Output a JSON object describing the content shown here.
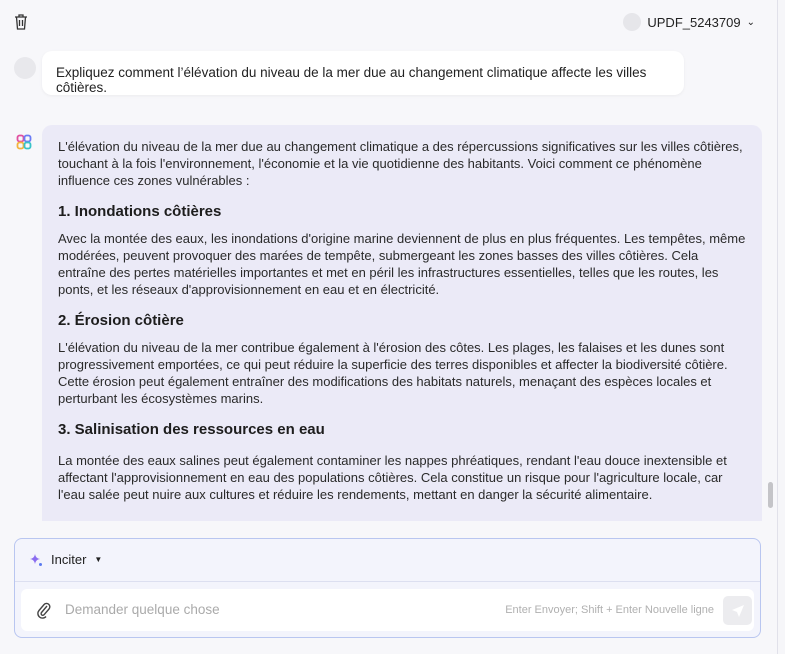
{
  "header": {
    "username": "UPDF_5243709"
  },
  "question": "Expliquez comment l’élévation du niveau de la mer due au changement climatique affecte les villes côtières.",
  "answer": {
    "intro": "L'élévation du niveau de la mer due au changement climatique a des répercussions significatives sur les villes côtières, touchant à la fois l'environnement, l'économie et la vie quotidienne des habitants. Voici comment ce phénomène influence ces zones vulnérables :",
    "sections": [
      {
        "title": "1. Inondations côtières",
        "text": "Avec la montée des eaux, les inondations d'origine marine deviennent de plus en plus fréquentes. Les tempêtes, même modérées, peuvent provoquer des marées de tempête, submergeant les zones basses des villes côtières. Cela entraîne des pertes matérielles importantes et met en péril les infrastructures essentielles, telles que les routes, les ponts, et les réseaux d'approvisionnement en eau et en électricité."
      },
      {
        "title": "2. Érosion côtière",
        "text": "L'élévation du niveau de la mer contribue également à l'érosion des côtes. Les plages, les falaises et les dunes sont progressivement emportées, ce qui peut réduire la superficie des terres disponibles et affecter la biodiversité côtière. Cette érosion peut également entraîner des modifications des habitats naturels, menaçant des espèces locales et perturbant les écosystèmes marins."
      },
      {
        "title": "3. Salinisation des ressources en eau",
        "text": "La montée des eaux salines peut également contaminer les nappes phréatiques, rendant l'eau douce inextensible et affectant l'approvisionnement en eau des populations côtières. Cela constitue un risque pour l'agriculture locale, car l'eau salée peut nuire aux cultures et réduire les rendements, mettant en danger la sécurité alimentaire."
      }
    ]
  },
  "input": {
    "prompt_label": "Inciter",
    "placeholder": "Demander quelque chose",
    "hint": "Enter Envoyer; Shift + Enter Nouvelle ligne"
  }
}
